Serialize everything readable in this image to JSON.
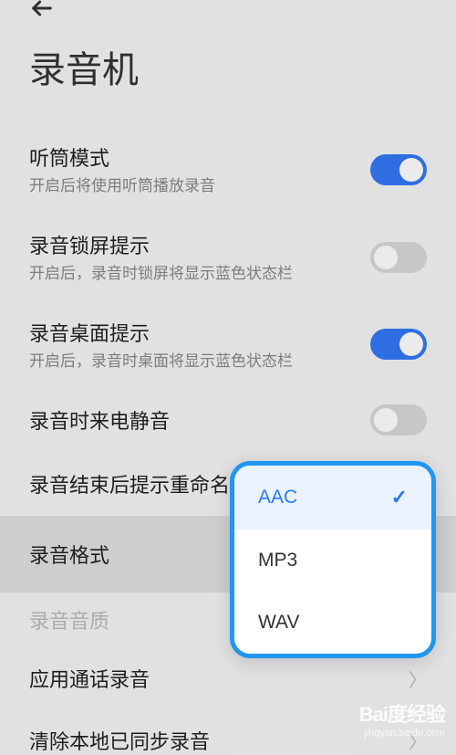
{
  "header": {
    "title": "录音机"
  },
  "settings": {
    "earpiece": {
      "title": "听筒模式",
      "desc": "开启后将使用听筒播放录音",
      "state": true
    },
    "lockscreen": {
      "title": "录音锁屏提示",
      "desc": "开启后，录音时锁屏将显示蓝色状态栏",
      "state": false
    },
    "desktop": {
      "title": "录音桌面提示",
      "desc": "开启后，录音时桌面将显示蓝色状态栏",
      "state": true
    },
    "mute_call": {
      "title": "录音时来电静音",
      "state": false
    },
    "rename": {
      "title": "录音结束后提示重命名",
      "state": true
    },
    "format": {
      "title": "录音格式"
    },
    "quality": {
      "title": "录音音质"
    },
    "call_record": {
      "title": "应用通话录音"
    },
    "sync": {
      "title": "清除本地已同步录音"
    }
  },
  "format_popup": {
    "options": [
      {
        "label": "AAC",
        "selected": true
      },
      {
        "label": "MP3",
        "selected": false
      },
      {
        "label": "WAV",
        "selected": false
      }
    ]
  },
  "watermark": {
    "logo": "Bai度经验",
    "url": "jingyan.baidu.com"
  }
}
